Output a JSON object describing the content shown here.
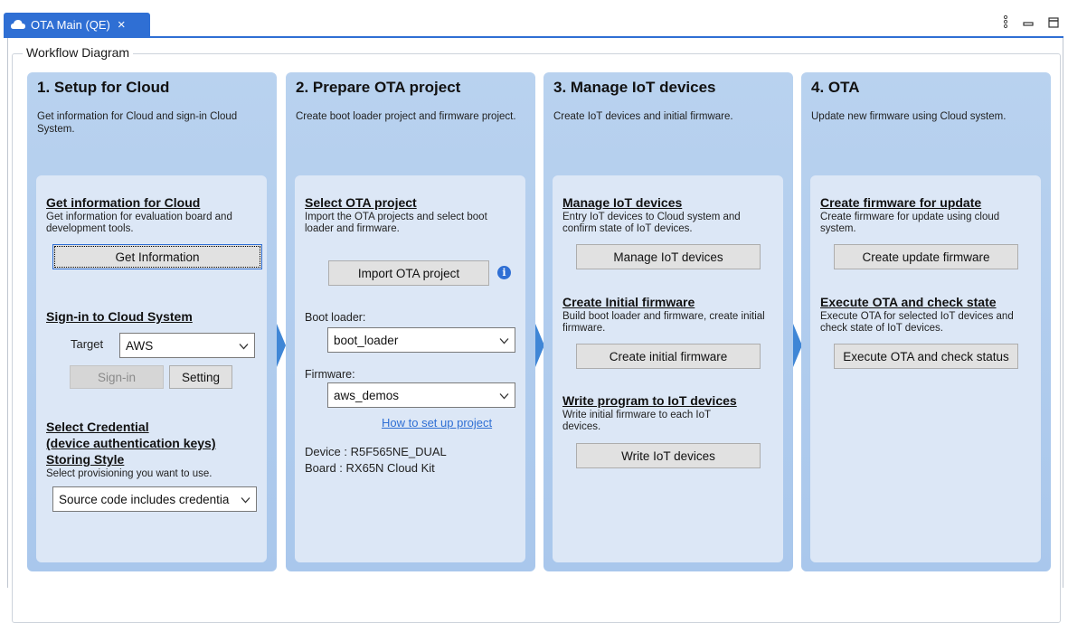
{
  "tab": {
    "title": "OTA Main (QE)",
    "close": "×"
  },
  "view_icons": {
    "menu": "⋮",
    "minimize": "▭",
    "maximize": "□"
  },
  "group": {
    "label": "Workflow Diagram"
  },
  "columns": [
    {
      "title": "1. Setup for Cloud",
      "desc": "Get information for Cloud and sign-in Cloud System.",
      "get_info": {
        "title": "Get information for Cloud",
        "desc": "Get information for evaluation board and development tools.",
        "button": "Get Information"
      },
      "signin": {
        "title": "Sign-in to Cloud System",
        "target_label": "Target",
        "target_value": "AWS",
        "signin_button": "Sign-in",
        "setting_button": "Setting"
      },
      "credential": {
        "title_line1": "Select Credential",
        "title_line2": "(device authentication keys)",
        "title_line3": "Storing Style",
        "desc": "Select provisioning you want to use.",
        "select_value": "Source code includes credentia"
      }
    },
    {
      "title": "2. Prepare OTA project",
      "desc": "Create boot loader project and firmware project.",
      "select_ota": {
        "title": "Select OTA project",
        "desc": "Import the OTA projects and select boot loader and firmware.",
        "button": "Import OTA project"
      },
      "bootloader_label": "Boot loader:",
      "bootloader_value": "boot_loader",
      "firmware_label": "Firmware:",
      "firmware_value": "aws_demos",
      "howto_link": "How to set up project",
      "device": "Device : R5F565NE_DUAL",
      "board": "Board : RX65N Cloud Kit"
    },
    {
      "title": "3. Manage IoT devices",
      "desc": "Create IoT devices and initial firmware.",
      "manage": {
        "title": "Manage IoT devices",
        "desc": "Entry IoT devices to Cloud system and confirm state of IoT devices.",
        "button": "Manage IoT devices"
      },
      "initial": {
        "title": "Create Initial firmware",
        "desc": "Build boot loader and firmware, create initial firmware.",
        "button": "Create initial firmware"
      },
      "write": {
        "title": "Write program to IoT devices",
        "desc": "Write initial firmware to each IoT devices.",
        "button": "Write IoT devices"
      }
    },
    {
      "title": "4. OTA",
      "desc": "Update new firmware using Cloud system.",
      "update": {
        "title": "Create firmware for update",
        "desc": "Create firmware for update using cloud system.",
        "button": "Create update firmware"
      },
      "execute": {
        "title": "Execute OTA and check state",
        "desc": "Execute OTA for selected IoT devices and check state of IoT devices.",
        "button": "Execute OTA and check status"
      }
    }
  ],
  "colors": {
    "accent": "#2f6fd4",
    "column_bg": "#b0cbee",
    "inner_bg": "#dce7f6",
    "arrow": "#3f86d6"
  }
}
